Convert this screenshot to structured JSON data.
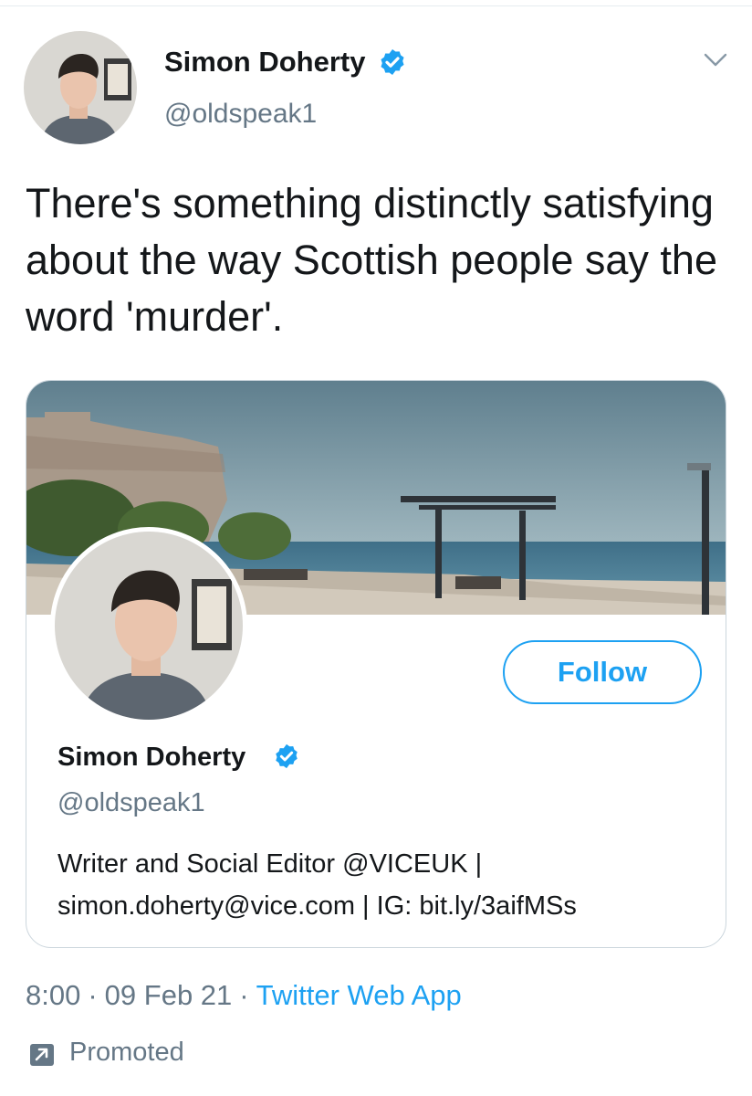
{
  "tweet": {
    "author_name": "Simon Doherty",
    "author_handle": "@oldspeak1",
    "text": "There's something distinctly satisfying about the way Scottish people say the word 'murder'.",
    "timestamp_time": "8:00",
    "timestamp_date": "09 Feb 21",
    "separator": "·",
    "source": "Twitter Web App",
    "promoted_label": "Promoted"
  },
  "profile_card": {
    "name": "Simon Doherty",
    "handle": "@oldspeak1",
    "follow_label": "Follow",
    "bio_line1": "Writer and Social Editor @VICEUK |",
    "bio_line2": "simon.doherty@vice.com | IG: bit.ly/3aifMSs"
  },
  "icons": {
    "verified": "verified-badge-icon",
    "caret": "chevron-down-icon",
    "promoted": "promoted-arrow-icon"
  },
  "colors": {
    "accent": "#1da1f2",
    "secondary_text": "#657786",
    "primary_text": "#14171a",
    "border": "#ccd6dd"
  }
}
